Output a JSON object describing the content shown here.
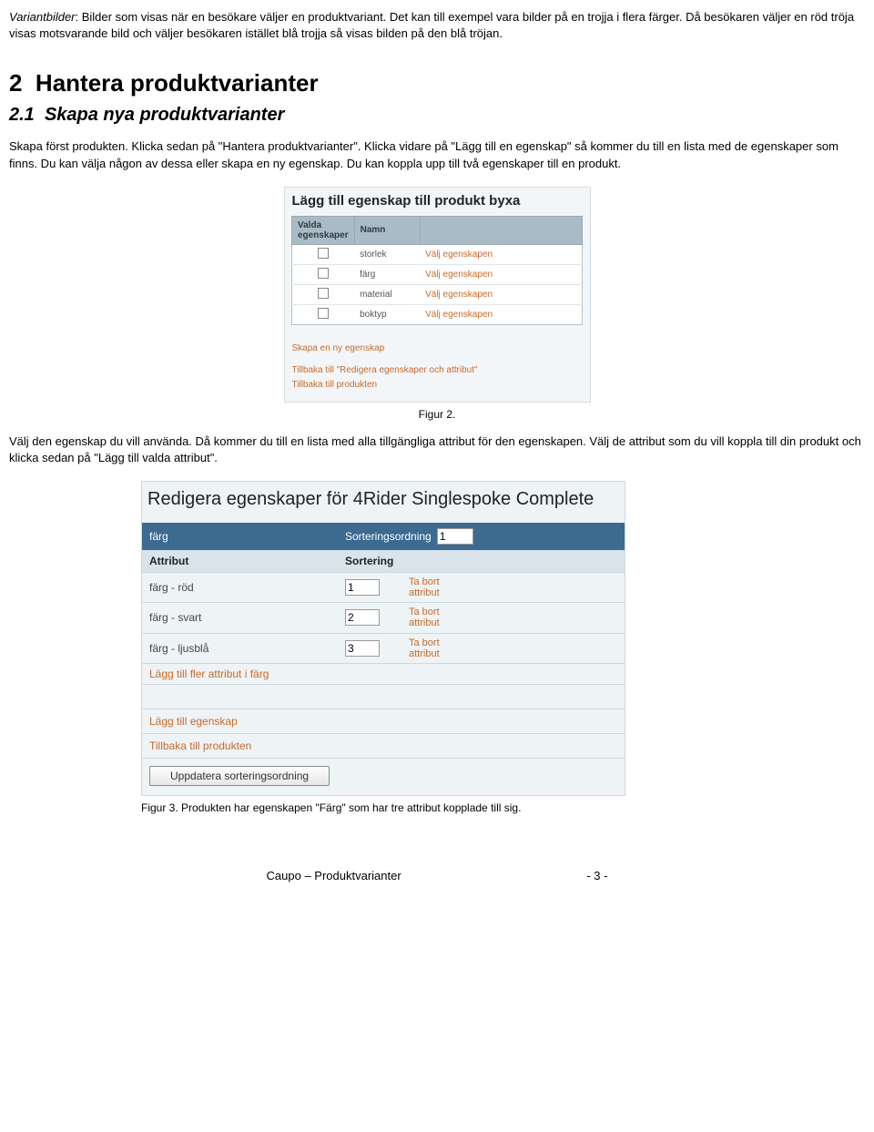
{
  "intro": {
    "term": "Variantbilder",
    "text": ": Bilder som visas när en besökare väljer en produktvariant. Det kan till exempel vara bilder på en trojja i flera färger. Då besökaren väljer en röd tröja visas motsvarande bild och väljer besökaren istället blå trojja så visas bilden på den blå tröjan."
  },
  "section": {
    "number": "2",
    "title": "Hantera produktvarianter",
    "sub_number": "2.1",
    "sub_title": "Skapa nya produktvarianter"
  },
  "body1": "Skapa först produkten. Klicka sedan på \"Hantera produktvarianter\". Klicka vidare på \"Lägg till en egenskap\" så kommer du till en lista med de egenskaper som finns. Du kan välja någon av dessa eller skapa en ny egenskap. Du kan koppla upp till två egenskaper till en produkt.",
  "figure2": {
    "title": "Lägg till egenskap till produkt byxa",
    "th_checked": "Valda egenskaper",
    "th_name": "Namn",
    "th_blank": "",
    "action_label": "Välj egenskapen",
    "rows": [
      "storlek",
      "färg",
      "material",
      "boktyp"
    ],
    "link_new": "Skapa en ny egenskap",
    "link_back1": "Tillbaka till \"Redigera egenskaper och attribut\"",
    "link_back2": "Tillbaka till produkten",
    "caption": "Figur 2."
  },
  "body2": "Välj den egenskap du vill använda. Då kommer du till en lista med alla tillgängliga attribut för den egenskapen. Välj de attribut som du vill koppla till din produkt och klicka sedan på \"Lägg till valda attribut\".",
  "figure3": {
    "title": "Redigera egenskaper för 4Rider Singlespoke Complete",
    "bar_label": "färg",
    "bar_sort_label": "Sorteringsordning",
    "bar_sort_value": "1",
    "hdr_attr": "Attribut",
    "hdr_sort": "Sortering",
    "remove_label": "Ta bort attribut",
    "rows": [
      {
        "name": "färg - röd",
        "sort": "1"
      },
      {
        "name": "färg - svart",
        "sort": "2"
      },
      {
        "name": "färg - ljusblå",
        "sort": "3"
      }
    ],
    "link_more": "Lägg till fler attribut i färg",
    "link_add_prop": "Lägg till egenskap",
    "link_back": "Tillbaka till produkten",
    "button": "Uppdatera sorteringsordning",
    "caption": "Figur 3. Produkten har egenskapen \"Färg\" som har tre attribut kopplade till sig."
  },
  "footer": {
    "left": "Caupo – Produktvarianter",
    "right": "- 3 -"
  }
}
